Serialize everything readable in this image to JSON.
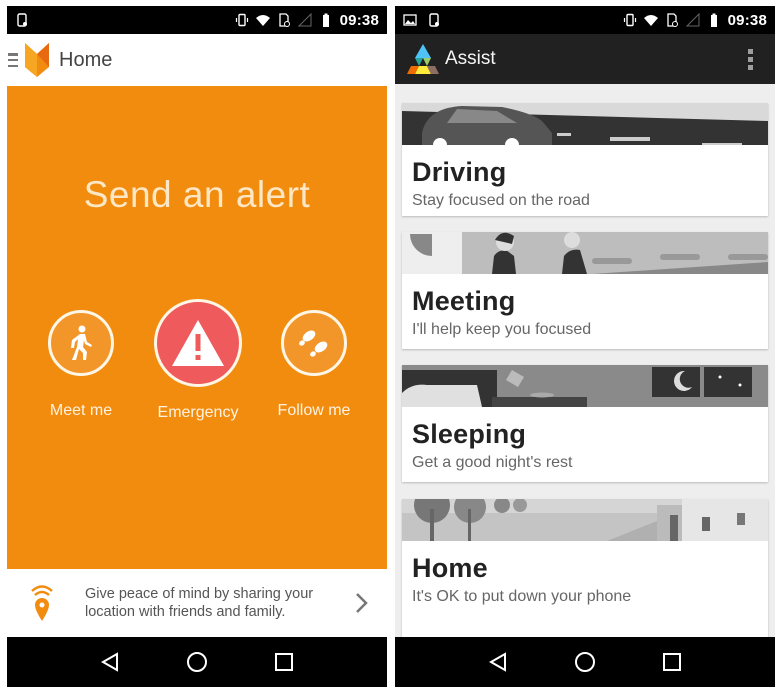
{
  "status_bar": {
    "time": "09:38"
  },
  "left_screen": {
    "app_title": "Home",
    "alert_heading": "Send an alert",
    "actions": [
      {
        "label": "Meet me",
        "icon": "walking-person-icon"
      },
      {
        "label": "Emergency",
        "icon": "warning-triangle-icon"
      },
      {
        "label": "Follow me",
        "icon": "footprints-icon"
      }
    ],
    "share_prompt": "Give peace of mind by sharing your location with friends and family.",
    "colors": {
      "accent": "#f28c0f",
      "emergency": "#ef5a5c"
    }
  },
  "right_screen": {
    "app_title": "Assist",
    "cards": [
      {
        "title": "Driving",
        "subtitle": "Stay focused on the road"
      },
      {
        "title": "Meeting",
        "subtitle": "I'll help keep you focused"
      },
      {
        "title": "Sleeping",
        "subtitle": "Get a good night's rest"
      },
      {
        "title": "Home",
        "subtitle": "It's OK to put down your phone"
      }
    ],
    "colors": {
      "appbar": "#212121",
      "background": "#eeeeee"
    }
  }
}
